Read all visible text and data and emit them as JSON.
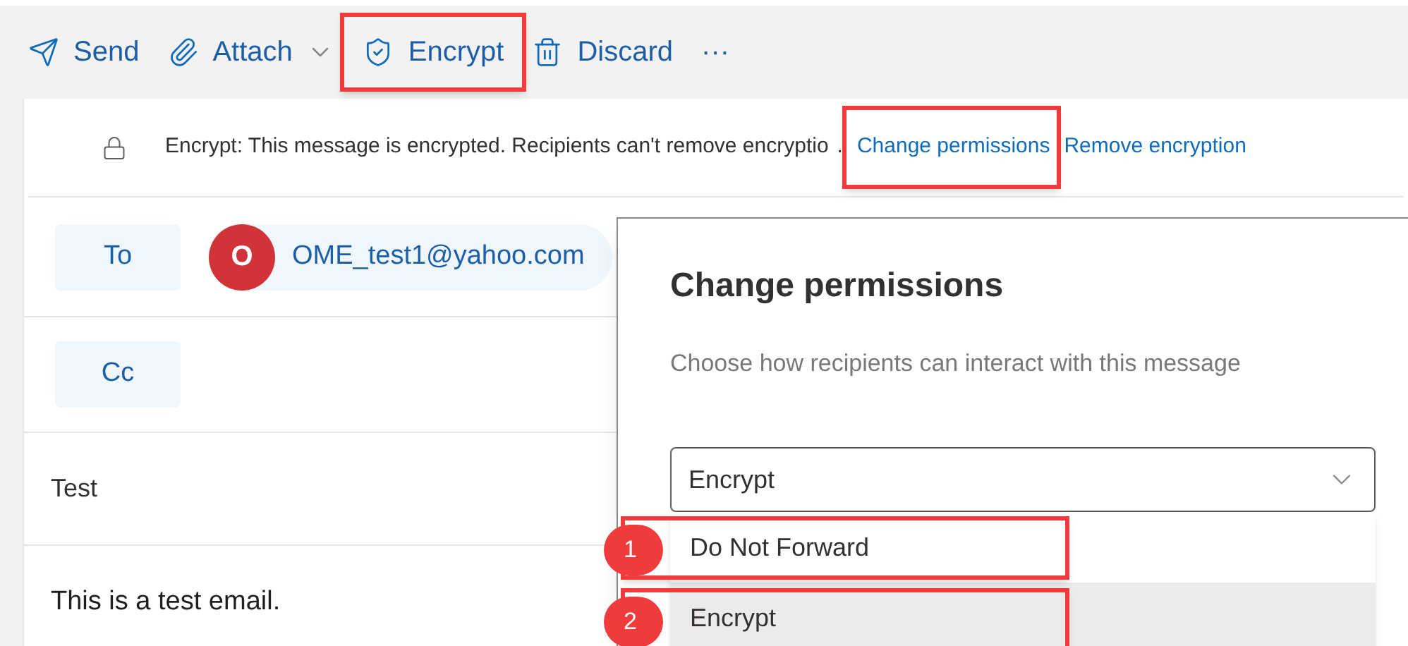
{
  "toolbar": [
    {
      "kind": "send",
      "label": "Send",
      "highlighted": false
    },
    {
      "kind": "attach",
      "label": "Attach",
      "highlighted": false
    },
    {
      "kind": "encrypt",
      "label": "Encrypt",
      "highlighted": true
    },
    {
      "kind": "discard",
      "label": "Discard",
      "highlighted": false
    },
    {
      "kind": "more",
      "label": "···",
      "highlighted": false
    }
  ],
  "info_bar": {
    "message": "Encrypt: This message is encrypted. Recipients can't remove encryptio",
    "separator": ".",
    "links": [
      {
        "label": "Change permissions",
        "highlighted": true
      },
      {
        "label": "Remove encryption",
        "highlighted": false
      }
    ]
  },
  "to": {
    "label": "To",
    "recipients": [
      {
        "initial": "O",
        "address": "OME_test1@yahoo.com",
        "color": "#d13438"
      }
    ]
  },
  "cc": {
    "label": "Cc"
  },
  "subject": "Test",
  "body": "This is a test email.",
  "dialog": {
    "title": "Change permissions",
    "description": "Choose how recipients can interact with this message",
    "select": {
      "value": "Encrypt"
    },
    "options": [
      {
        "label": "Do Not Forward",
        "selected": false,
        "step": "1"
      },
      {
        "label": "Encrypt",
        "selected": true,
        "step": "2"
      }
    ]
  }
}
